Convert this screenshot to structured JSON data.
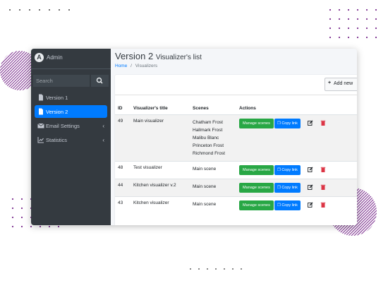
{
  "sidebar": {
    "brand": "Admin",
    "brand_initial": "A",
    "search_placeholder": "Search",
    "items": [
      {
        "label": "Version 1",
        "icon": "file-icon",
        "active": false
      },
      {
        "label": "Version 2",
        "icon": "file-icon",
        "active": true
      },
      {
        "label": "Email Settings",
        "icon": "envelope-icon",
        "chevron": "‹"
      },
      {
        "label": "Statistics",
        "icon": "chart-icon",
        "chevron": "‹"
      }
    ]
  },
  "header": {
    "title": "Version 2",
    "subtitle": "Visualizer's list",
    "breadcrumb": {
      "home": "Home",
      "sep": "/",
      "current": "Visualizers"
    }
  },
  "toolbar": {
    "add_label": "Add new",
    "add_icon": "+"
  },
  "table": {
    "columns": [
      "ID",
      "Visualizer's title",
      "Scenes",
      "Actions"
    ],
    "rows": [
      {
        "id": "49",
        "title": "Main visualizer",
        "scenes": [
          "Chatham Frost",
          "Hallmark Frost",
          "Malibu Blanc",
          "Princeton Frost",
          "Richmond Frost"
        ]
      },
      {
        "id": "48",
        "title": "Test visualizer",
        "scenes": [
          "Main scene"
        ]
      },
      {
        "id": "44",
        "title": "Kitchen visualizer v.2",
        "scenes": [
          "Main scene"
        ]
      },
      {
        "id": "43",
        "title": "Kitchen visualizer",
        "scenes": [
          "Main scene"
        ]
      }
    ],
    "manage_label": "Manage scenes",
    "copy_label": "Copy link"
  },
  "colors": {
    "sidebar": "#343a40",
    "primary": "#007bff",
    "success": "#28a745",
    "danger": "#dc3545",
    "decor": "#7b2d8e"
  }
}
